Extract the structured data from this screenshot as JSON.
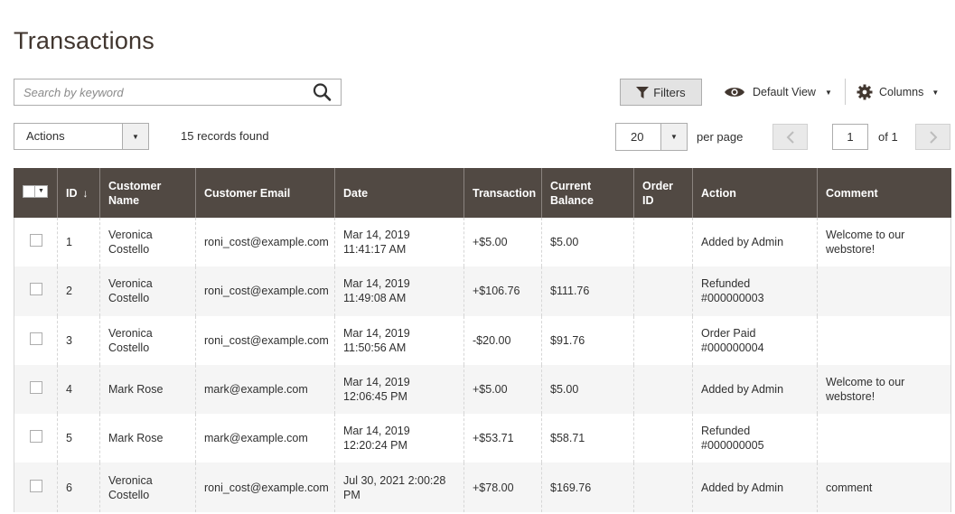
{
  "page": {
    "title": "Transactions"
  },
  "search": {
    "placeholder": "Search by keyword",
    "value": ""
  },
  "toolbar": {
    "filters_label": "Filters",
    "view_label": "Default View",
    "columns_label": "Columns"
  },
  "actions": {
    "label": "Actions"
  },
  "records_found": "15 records found",
  "pagination": {
    "per_page_value": "20",
    "per_page_label": "per page",
    "current_page": "1",
    "of_label": "of 1"
  },
  "table": {
    "columns": {
      "id": "ID",
      "customer_name": "Customer Name",
      "customer_email": "Customer Email",
      "date": "Date",
      "transaction": "Transaction",
      "current_balance": "Current Balance",
      "order_id": "Order ID",
      "action": "Action",
      "comment": "Comment"
    },
    "rows": [
      {
        "id": "1",
        "name": "Veronica Costello",
        "email": "roni_cost@example.com",
        "date": "Mar 14, 2019 11:41:17 AM",
        "transaction": "+$5.00",
        "sign": "pos",
        "balance": "$5.00",
        "order_id": "",
        "action": "Added by Admin",
        "comment": "Welcome to our webstore!"
      },
      {
        "id": "2",
        "name": "Veronica Costello",
        "email": "roni_cost@example.com",
        "date": "Mar 14, 2019 11:49:08 AM",
        "transaction": "+$106.76",
        "sign": "pos",
        "balance": "$111.76",
        "order_id": "",
        "action": "Refunded #000000003",
        "comment": ""
      },
      {
        "id": "3",
        "name": "Veronica Costello",
        "email": "roni_cost@example.com",
        "date": "Mar 14, 2019 11:50:56 AM",
        "transaction": "-$20.00",
        "sign": "neg",
        "balance": "$91.76",
        "order_id": "",
        "action": "Order Paid #000000004",
        "comment": ""
      },
      {
        "id": "4",
        "name": "Mark Rose",
        "email": "mark@example.com",
        "date": "Mar 14, 2019 12:06:45 PM",
        "transaction": "+$5.00",
        "sign": "pos",
        "balance": "$5.00",
        "order_id": "",
        "action": "Added by Admin",
        "comment": "Welcome to our webstore!"
      },
      {
        "id": "5",
        "name": "Mark Rose",
        "email": "mark@example.com",
        "date": "Mar 14, 2019 12:20:24 PM",
        "transaction": "+$53.71",
        "sign": "pos",
        "balance": "$58.71",
        "order_id": "",
        "action": "Refunded #000000005",
        "comment": ""
      },
      {
        "id": "6",
        "name": "Veronica Costello",
        "email": "roni_cost@example.com",
        "date": "Jul 30, 2021 2:00:28 PM",
        "transaction": "+$78.00",
        "sign": "pos",
        "balance": "$169.76",
        "order_id": "",
        "action": "Added by Admin",
        "comment": "comment"
      }
    ]
  },
  "colors": {
    "header_bg": "#514943",
    "positive": "#1f8b24",
    "negative": "#e22626",
    "title": "#41362f"
  },
  "icons": {
    "search": "search-icon",
    "filter": "filter-icon",
    "view": "eye-icon",
    "columns": "gear-icon"
  }
}
